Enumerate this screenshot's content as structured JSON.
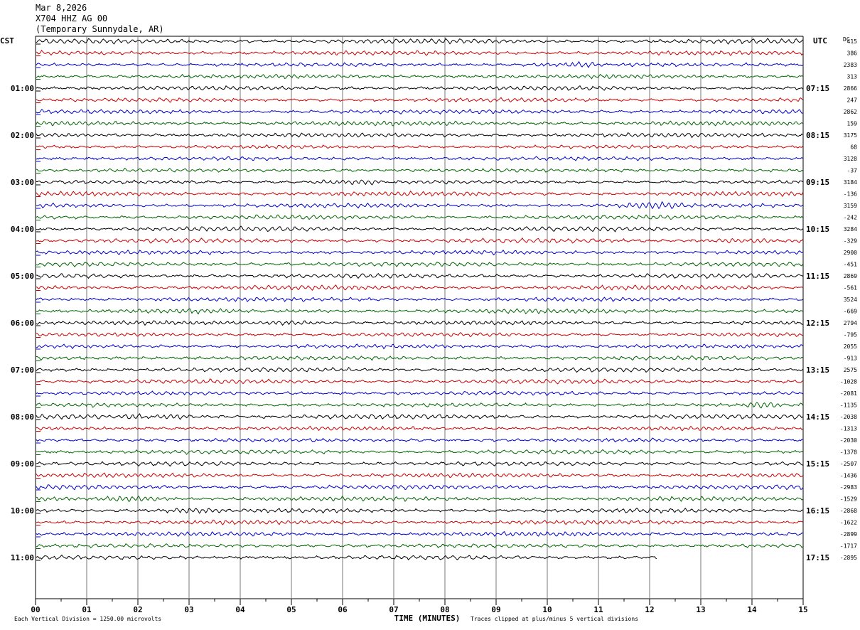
{
  "header": {
    "date": "Mar 8,2026",
    "station": "X704 HHZ AG 00",
    "location": "(Temporary Sunnydale, AR)"
  },
  "footer": {
    "scale_note": "Each Vertical Division = 1250.00 microvolts",
    "clip_note": "Traces clipped at plus/minus 5 vertical divisions"
  },
  "chart_data": {
    "type": "line",
    "title": "",
    "xlabel": "TIME (MINUTES)",
    "left_axis_title": "CST",
    "right_axis_title": "UTC",
    "dc_label": "DC",
    "x_ticks": [
      "00",
      "01",
      "02",
      "03",
      "04",
      "05",
      "06",
      "07",
      "08",
      "09",
      "10",
      "11",
      "12",
      "13",
      "14",
      "15"
    ],
    "xlim": [
      0,
      15
    ],
    "grid": "vertical",
    "trace_minutes": 15,
    "trace_colors": [
      "#000000",
      "#cc0000",
      "#0000cc",
      "#006600"
    ],
    "left_time_labels": [
      "01:00",
      "02:00",
      "03:00",
      "04:00",
      "05:00",
      "06:00",
      "07:00",
      "08:00",
      "09:00",
      "10:00",
      "11:00"
    ],
    "right_time_labels": [
      "07:15",
      "08:15",
      "09:15",
      "10:15",
      "11:15",
      "12:15",
      "13:15",
      "14:15",
      "15:15",
      "16:15",
      "17:15"
    ],
    "dc_values": [
      "415",
      "386",
      "2383",
      "313",
      "2866",
      "247",
      "2862",
      "159",
      "3175",
      "68",
      "3128",
      "-37",
      "3184",
      "-136",
      "3159",
      "-242",
      "3284",
      "-329",
      "2900",
      "-451",
      "2869",
      "-561",
      "3524",
      "-669",
      "2794",
      "-795",
      "2055",
      "-913",
      "2575",
      "-1028",
      "-2081",
      "-1135",
      "-2038",
      "-1313",
      "-2030",
      "-1378",
      "-2507",
      "-1436",
      "-2983",
      "-1529",
      "-2868",
      "-1622",
      "-2899",
      "-1717",
      "-2895"
    ],
    "last_trace_end_minute": 12.15,
    "series": [
      {
        "name": "",
        "values": [
          415,
          386,
          2383,
          313,
          2866,
          247,
          2862,
          159,
          3175,
          68,
          3128,
          -37,
          3184,
          -136,
          3159,
          -242,
          3284,
          -329,
          2900,
          -451,
          2869,
          -561,
          3524,
          -669,
          2794,
          -795,
          2055,
          -913,
          2575,
          -1028,
          -2081,
          -1135,
          -2038,
          -1313,
          -2030,
          -1378,
          -2507,
          -1436,
          -2983,
          -1529,
          -2868,
          -1622,
          -2899,
          -1717,
          -2895
        ]
      }
    ]
  }
}
